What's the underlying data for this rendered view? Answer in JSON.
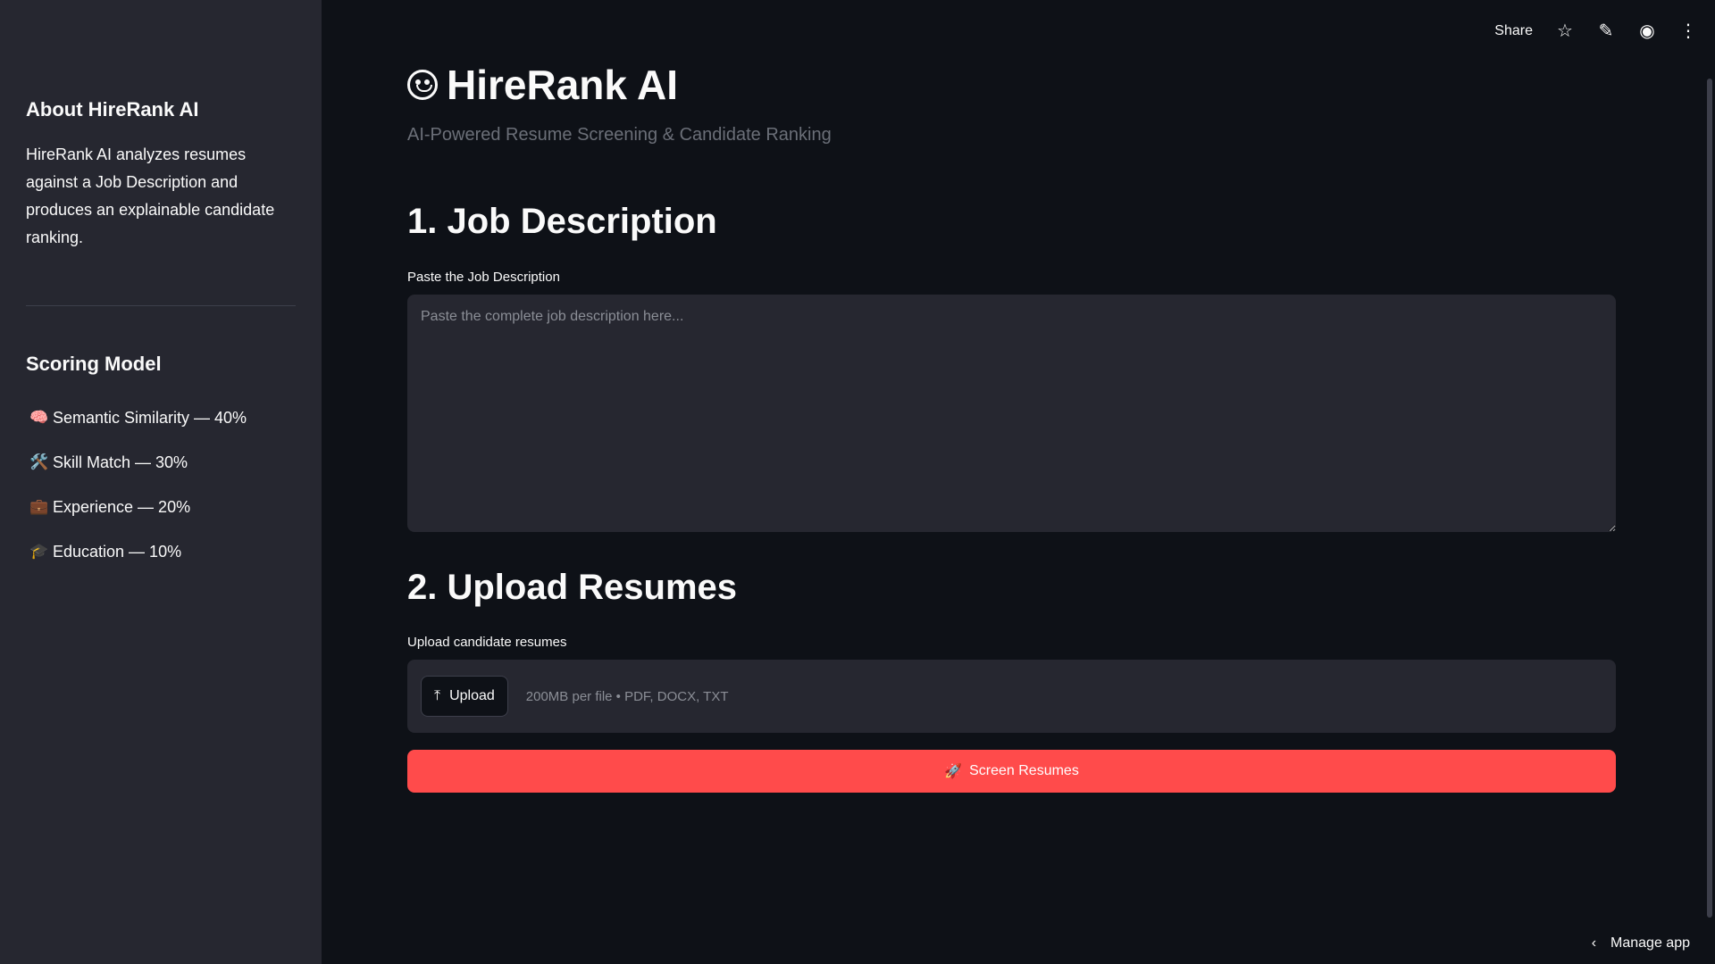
{
  "sidebar": {
    "about_title": "About HireRank AI",
    "about_text": "HireRank AI analyzes resumes against a Job Description and produces an explainable candidate ranking.",
    "scoring_title": "Scoring Model",
    "scoring_items": [
      {
        "emoji": "🧠",
        "label": "Semantic Similarity — 40%"
      },
      {
        "emoji": "🛠️",
        "label": "Skill Match — 30%"
      },
      {
        "emoji": "💼",
        "label": "Experience — 20%"
      },
      {
        "emoji": "🎓",
        "label": "Education — 10%"
      }
    ]
  },
  "header": {
    "share_label": "Share",
    "star_icon": "☆",
    "edit_icon": "✎",
    "github_icon": "◉",
    "menu_icon": "⋮"
  },
  "main": {
    "title": "HireRank AI",
    "subtitle": "AI-Powered Resume Screening & Candidate Ranking",
    "section1_title": "1. Job Description",
    "jd_label": "Paste the Job Description",
    "jd_placeholder": "Paste the complete job description here...",
    "section2_title": "2. Upload Resumes",
    "upload_label": "Upload candidate resumes",
    "upload_button": "Upload",
    "upload_icon": "⤒",
    "upload_hint": "200MB per file • PDF, DOCX, TXT",
    "screen_button": "Screen Resumes",
    "screen_icon": "🚀"
  },
  "footer": {
    "manage_label": "Manage app",
    "chevron": "‹"
  },
  "colors": {
    "background": "#0e1117",
    "sidebar": "#262730",
    "primary": "#ff4b4b"
  }
}
